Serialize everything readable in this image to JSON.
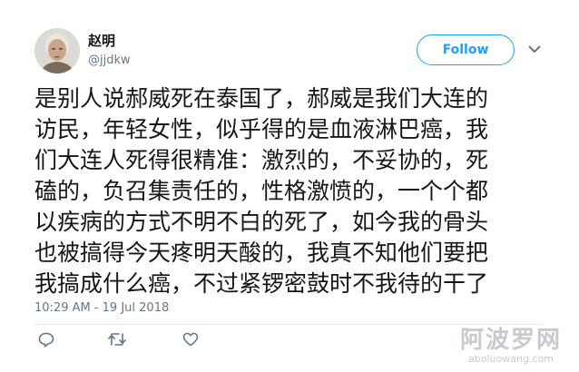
{
  "tweet": {
    "author": {
      "display_name": "赵明",
      "handle": "@jjdkw",
      "avatar_icon": "user-avatar-photo"
    },
    "follow_label": "Follow",
    "text_lines": [
      "是别人说郝威死在泰国了，郝威是我们大连的",
      "访民，年轻女性，似乎得的是血液淋巴癌，我",
      "们大连人死得很精准：激烈的，不妥协的，死",
      "磕的，负召集责任的，性格激愤的，一个个都",
      "以疾病的方式不明不白的死了，如今我的骨头",
      "也被搞得今天疼明天酸的，我真不知他们要把",
      "我搞成什么癌，不过紧锣密鼓时不我待的干了"
    ],
    "timestamp": "10:29 AM - 19 Jul 2018",
    "actions": {
      "reply_icon": "reply-icon",
      "retweet_icon": "retweet-icon",
      "like_icon": "heart-icon"
    }
  },
  "watermark": {
    "text": "阿波罗网",
    "url": "aboluowang.com"
  },
  "colors": {
    "accent": "#1da1f2",
    "text": "#14171a",
    "muted": "#657786",
    "divider": "#e6ecf0"
  }
}
